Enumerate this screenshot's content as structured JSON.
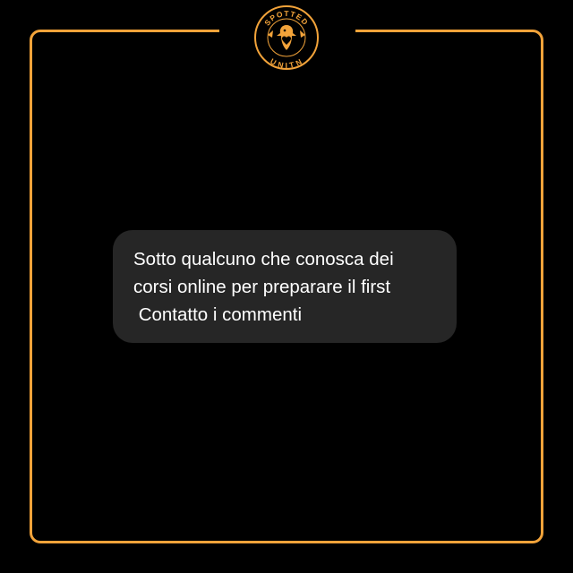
{
  "logo": {
    "top_text": "SPOTTED",
    "bottom_text": "UNITN",
    "icon": "eagle-heart-icon"
  },
  "message": {
    "lines": [
      "Sotto qualcuno che conosca dei",
      "corsi online per preparare il first",
      " Contatto i commenti"
    ]
  },
  "colors": {
    "accent": "#f2a33a",
    "background": "#000000",
    "bubble": "#262626",
    "text": "#ffffff"
  }
}
